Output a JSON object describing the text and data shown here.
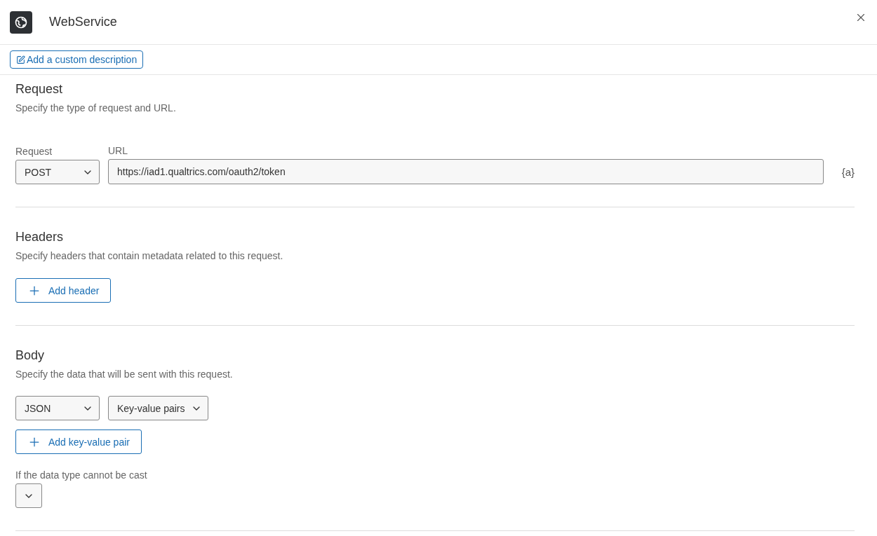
{
  "header": {
    "title": "WebService"
  },
  "description_button": "Add a custom description",
  "request": {
    "title": "Request",
    "subtitle": "Specify the type of request and URL.",
    "method_label": "Request",
    "method": "POST",
    "url_label": "URL",
    "url": "https://iad1.qualtrics.com/oauth2/token",
    "variable_token": "{a}"
  },
  "headers": {
    "title": "Headers",
    "subtitle": "Specify headers that contain metadata related to this request.",
    "add_button": "Add header"
  },
  "body": {
    "title": "Body",
    "subtitle": "Specify the data that will be sent with this request.",
    "format": "JSON",
    "mode": "Key-value pairs",
    "add_button": "Add key-value pair",
    "cast_label": "If the data type cannot be cast"
  }
}
